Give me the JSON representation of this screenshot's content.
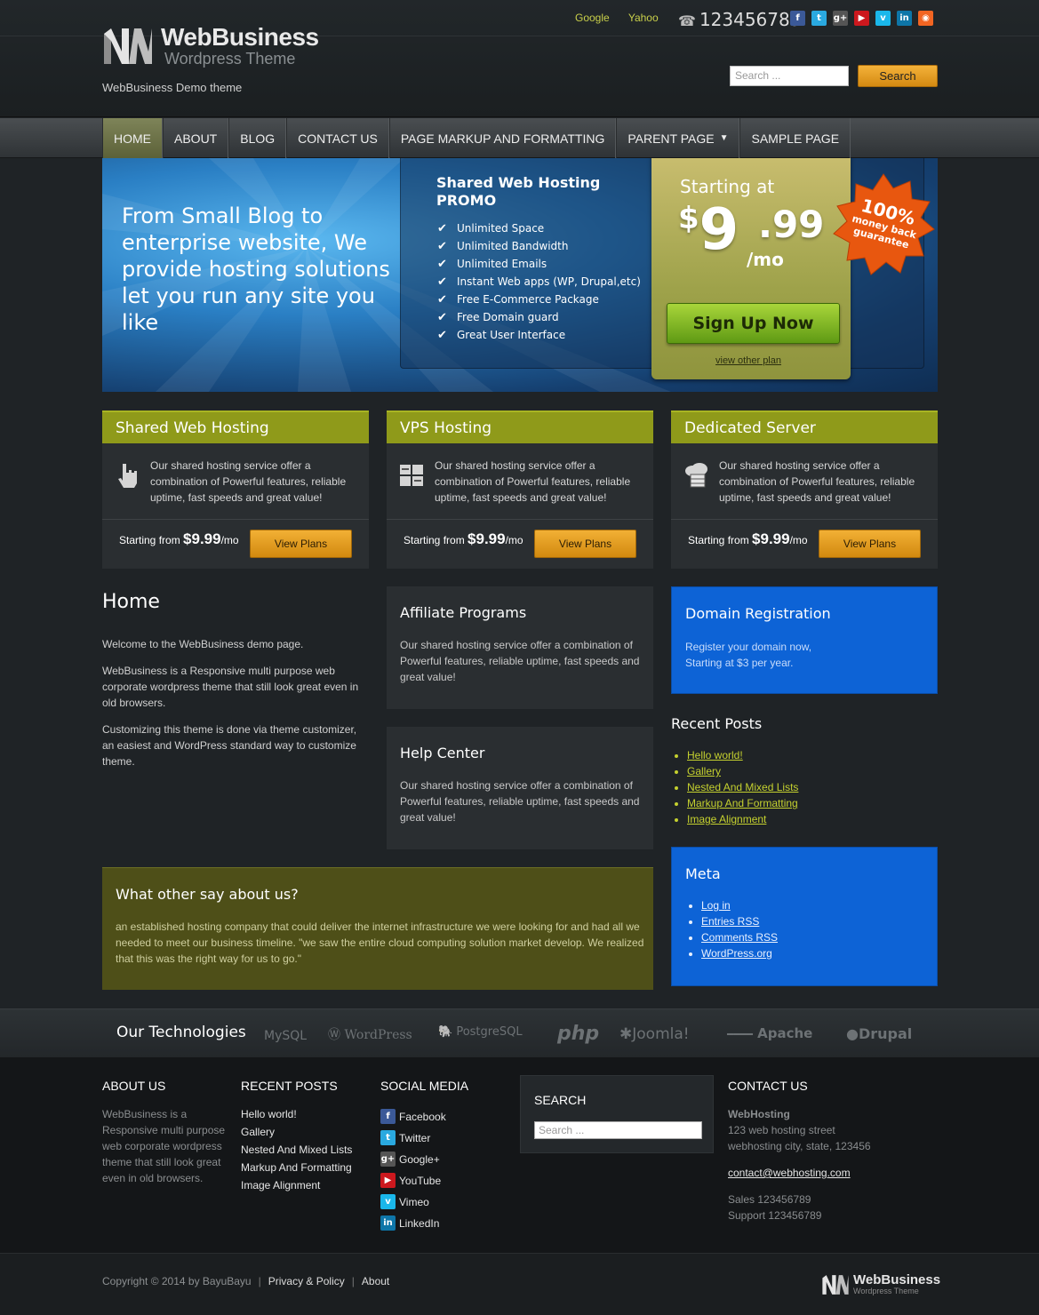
{
  "topbar": {
    "links": [
      "Google",
      "Yahoo"
    ],
    "phone": "123456789",
    "social_icons": [
      {
        "icon": "facebook-icon",
        "glyph": "f",
        "color": "#3b5998"
      },
      {
        "icon": "twitter-icon",
        "glyph": "t",
        "color": "#2aa9e0"
      },
      {
        "icon": "googleplus-icon",
        "glyph": "g+",
        "color": "#555555"
      },
      {
        "icon": "youtube-icon",
        "glyph": "▶",
        "color": "#cc181e"
      },
      {
        "icon": "vimeo-icon",
        "glyph": "v",
        "color": "#1ab7ea"
      },
      {
        "icon": "linkedin-icon",
        "glyph": "in",
        "color": "#0e76a8"
      },
      {
        "icon": "rss-icon",
        "glyph": "◉",
        "color": "#f26522"
      }
    ]
  },
  "brand": {
    "name": "WebBusiness",
    "subtitle": "Wordpress Theme",
    "tagline": "WebBusiness Demo theme"
  },
  "search": {
    "placeholder": "Search ...",
    "button": "Search"
  },
  "nav": {
    "items": [
      "HOME",
      "ABOUT",
      "BLOG",
      "CONTACT US",
      "PAGE MARKUP AND FORMATTING",
      "PARENT PAGE",
      "SAMPLE PAGE"
    ],
    "active": "HOME"
  },
  "hero": {
    "headline": "From Small Blog to enterprise website, We provide hosting solutions let you run any site you like",
    "promo_title": "Shared Web Hosting PROMO",
    "features": [
      "Unlimited Space",
      "Unlimited Bandwidth",
      "Unlimited Emails",
      "Instant Web apps (WP, Drupal,etc)",
      "Free E-Commerce Package",
      "Free Domain guard",
      "Great User Interface"
    ],
    "starting_at": "Starting at",
    "price_dollar": "$",
    "price_int": "9",
    "price_cents": ".99",
    "price_period": "/mo",
    "signup": "Sign Up Now",
    "other_plan": "view other plan",
    "badge_pct": "100%",
    "badge_line1": "money back",
    "badge_line2": "guarantee"
  },
  "plans": [
    {
      "title": "Shared Web Hosting",
      "icon": "hand-pointer-icon",
      "desc": "Our shared hosting service offer a combination of Powerful features, reliable uptime, fast speeds and great value!",
      "from": "Starting from",
      "price": "$9.99",
      "per": "/mo",
      "button": "View Plans"
    },
    {
      "title": "VPS Hosting",
      "icon": "server-icon",
      "desc": "Our shared hosting service offer a combination of Powerful features, reliable uptime, fast speeds and great value!",
      "from": "Starting from",
      "price": "$9.99",
      "per": "/mo",
      "button": "View Plans"
    },
    {
      "title": "Dedicated Server",
      "icon": "cloud-server-icon",
      "desc": "Our shared hosting service offer a combination of Powerful features, reliable uptime, fast speeds and great value!",
      "from": "Starting from",
      "price": "$9.99",
      "per": "/mo",
      "button": "View Plans"
    }
  ],
  "home": {
    "title": "Home",
    "paragraphs": [
      "Welcome to the WebBusiness demo page.",
      "WebBusiness is a Responsive multi purpose web corporate wordpress theme that still look great even in old browsers.",
      "Customizing this theme is done via theme customizer, an easiest and WordPress standard way to customize theme."
    ]
  },
  "affiliate": {
    "title": "Affiliate Programs",
    "text": "Our shared hosting service offer a combination of Powerful features, reliable uptime, fast speeds and great value!"
  },
  "help": {
    "title": "Help Center",
    "text": "Our shared hosting service offer a combination of Powerful features, reliable uptime, fast speeds and great value!"
  },
  "domain": {
    "title": "Domain Registration",
    "line1": "Register your domain now,",
    "line2": "Starting at $3 per year."
  },
  "recent_posts": {
    "title": "Recent Posts",
    "items": [
      "Hello world!",
      "Gallery",
      "Nested And Mixed Lists",
      "Markup And Formatting",
      "Image Alignment"
    ]
  },
  "meta": {
    "title": "Meta",
    "items": [
      "Log in",
      "Entries RSS",
      "Comments RSS",
      "WordPress.org"
    ]
  },
  "testimonial": {
    "title": "What other say about us?",
    "text": "an established hosting company that could deliver the internet infrastructure we were looking for and had all we needed to meet our business timeline. \"we saw the entire cloud computing solution market develop. We realized that this was the right way for us to go.\""
  },
  "technologies": {
    "title": "Our Technologies",
    "logos": [
      "MySQL",
      "WordPress",
      "PostgreSQL",
      "php",
      "Joomla!",
      "Apache",
      "Drupal"
    ]
  },
  "footer": {
    "about": {
      "title": "ABOUT US",
      "text": "WebBusiness is a Responsive multi purpose web corporate wordpress theme that still look great even in old browsers."
    },
    "recent": {
      "title": "RECENT POSTS",
      "items": [
        "Hello world!",
        "Gallery",
        "Nested And Mixed Lists",
        "Markup And Formatting",
        "Image Alignment"
      ]
    },
    "social": {
      "title": "SOCIAL MEDIA",
      "items": [
        {
          "label": "Facebook",
          "icon": "facebook-icon",
          "glyph": "f",
          "color": "#3b5998"
        },
        {
          "label": "Twitter",
          "icon": "twitter-icon",
          "glyph": "t",
          "color": "#2aa9e0"
        },
        {
          "label": "Google+",
          "icon": "googleplus-icon",
          "glyph": "g+",
          "color": "#555555"
        },
        {
          "label": "YouTube",
          "icon": "youtube-icon",
          "glyph": "▶",
          "color": "#cc181e"
        },
        {
          "label": "Vimeo",
          "icon": "vimeo-icon",
          "glyph": "v",
          "color": "#1ab7ea"
        },
        {
          "label": "LinkedIn",
          "icon": "linkedin-icon",
          "glyph": "in",
          "color": "#0e76a8"
        }
      ]
    },
    "search": {
      "title": "SEARCH",
      "placeholder": "Search ..."
    },
    "contact": {
      "title": "CONTACT US",
      "company": "WebHosting",
      "street": "123 web hosting street",
      "city": "webhosting city, state, 123456",
      "email": "contact@webhosting.com",
      "sales": "Sales 123456789",
      "support": "Support 123456789"
    }
  },
  "bottom": {
    "copyright": "Copyright © 2014 by BayuBayu",
    "links": [
      "Privacy & Policy",
      "About"
    ],
    "logo_name": "WebBusiness",
    "logo_sub": "Wordpress Theme"
  },
  "colors": {
    "accent_olive": "#8f9a1a",
    "button_orange": "#e19d22",
    "domain_blue": "#0d63d6",
    "link_green": "#c5d12f"
  }
}
